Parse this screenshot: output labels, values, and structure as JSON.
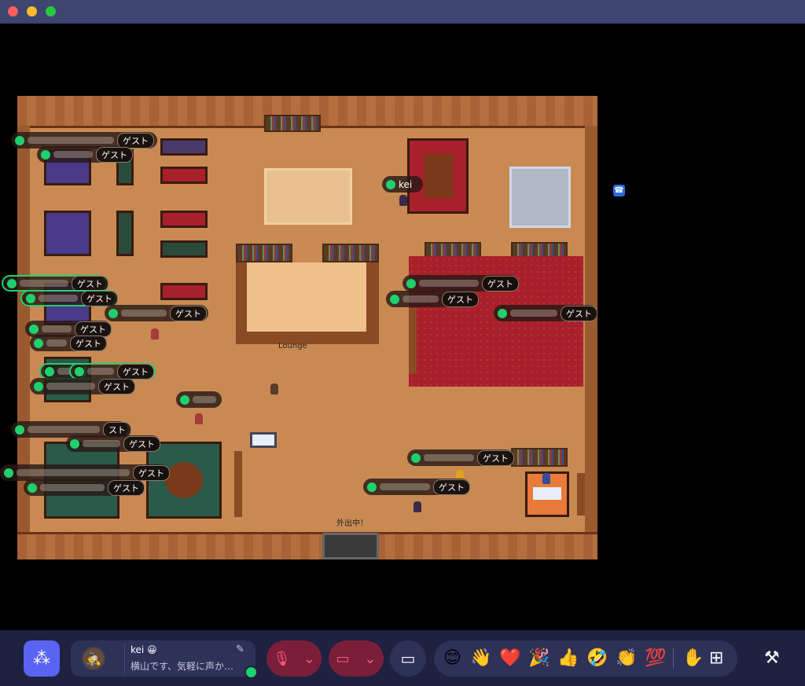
{
  "map": {
    "lounge_label": "Lounge",
    "away_sign": "外出中！",
    "colors": {
      "floor": "#c88a52",
      "wall": "#a86236",
      "status_online": "#1fd16e"
    }
  },
  "nametags": [
    {
      "name": "",
      "guest": "ゲスト"
    },
    {
      "name": "",
      "guest": "ゲスト"
    },
    {
      "name": "kei",
      "guest": ""
    },
    {
      "name": "",
      "guest": "ゲスト"
    },
    {
      "name": "",
      "guest": "ゲスト"
    },
    {
      "name": "",
      "guest": "ゲスト"
    },
    {
      "name": "",
      "guest": "ゲスト"
    },
    {
      "name": "",
      "guest": "ゲスト"
    },
    {
      "name": "",
      "guest": "ゲスト"
    },
    {
      "name": "",
      "guest": "ゲスト"
    },
    {
      "name": "",
      "guest": "ゲスト"
    },
    {
      "name": "",
      "guest": "ゲスト"
    },
    {
      "name": "",
      "guest": "ゲスト"
    },
    {
      "name": "",
      "guest": ""
    },
    {
      "name": "",
      "guest": "スト"
    },
    {
      "name": "",
      "guest": "ゲスト"
    },
    {
      "name": "",
      "guest": "ゲスト"
    },
    {
      "name": "",
      "guest": "ゲスト"
    },
    {
      "name": "",
      "guest": "ゲスト"
    },
    {
      "name": "",
      "guest": "ゲスト"
    }
  ],
  "toolbar": {
    "profile_name": "kei",
    "profile_status": "横山です、気軽に声か…",
    "emojis": [
      "😊",
      "👋",
      "❤️",
      "🎉",
      "👍",
      "🤣",
      "👏",
      "💯"
    ],
    "hand_icon": "raise-hand-icon",
    "apps_icon": "add-app-icon",
    "build_icon": "hammer-icon"
  }
}
